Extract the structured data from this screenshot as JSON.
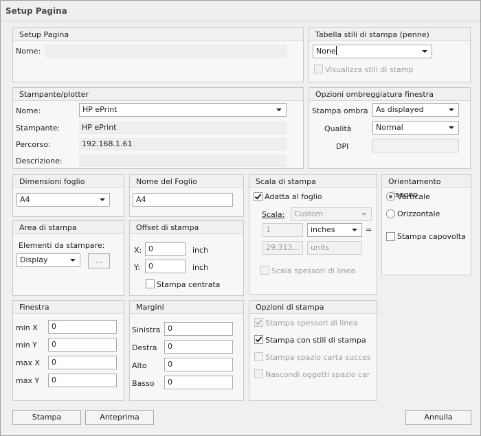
{
  "window": {
    "title": "Setup Pagina"
  },
  "setup": {
    "title": "Setup Pagina",
    "name_label": "Nome:",
    "name_value": ""
  },
  "pen": {
    "title": "Tabella stili di stampa (penne)",
    "value": "None",
    "view_label": "Visualizza stili di stamp"
  },
  "printer": {
    "title": "Stampante/plotter",
    "name_label": "Nome:",
    "name_value": "HP ePrint",
    "printer_label": "Stampante:",
    "printer_value": "HP ePrint",
    "path_label": "Percorso:",
    "path_value": "192.168.1.61",
    "desc_label": "Descrizione:",
    "desc_value": ""
  },
  "shade": {
    "title": "Opzioni ombreggiatura finestra",
    "shade_label": "Stampa ombra",
    "shade_value": "As displayed",
    "quality_label": "Qualità",
    "quality_value": "Normal",
    "dpi_label": "DPI",
    "dpi_value": ""
  },
  "paper": {
    "title": "Dimensioni foglio",
    "value": "A4"
  },
  "sheet": {
    "title": "Nome del Foglio",
    "value": "A4"
  },
  "scale": {
    "title": "Scala di stampa",
    "fit_label": "Adatta al foglio",
    "scale_label": "Scala:",
    "scale_value": "Custom",
    "num_value": "1",
    "unit_value": "inches",
    "equals": "=",
    "denom_value": "29.313...",
    "units_value": "units",
    "lineweight_label": "Scala spessori di linea"
  },
  "orient": {
    "title": "Orientamento disegno",
    "portrait_label": "Verticale",
    "landscape_label": "Orizzontale",
    "upside_label": "Stampa capovolta"
  },
  "area": {
    "title": "Area di stampa",
    "elements_label": "Elementi da stampare:",
    "value": "Display",
    "dots": "..."
  },
  "offset": {
    "title": "Offset di stampa",
    "x_label": "X:",
    "x_value": "0",
    "x_unit": "inch",
    "y_label": "Y:",
    "y_value": "0",
    "y_unit": "inch",
    "center_label": "Stampa centrata"
  },
  "window_box": {
    "title": "Finestra",
    "minx_label": "min X",
    "minx_value": "0",
    "miny_label": "min Y",
    "miny_value": "0",
    "maxx_label": "max X",
    "maxx_value": "0",
    "maxy_label": "max Y",
    "maxy_value": "0"
  },
  "margins": {
    "title": "Margini",
    "left_label": "Sinistra",
    "left_value": "0",
    "right_label": "Destra",
    "right_value": "0",
    "top_label": "Alto",
    "top_value": "0",
    "bottom_label": "Basso",
    "bottom_value": "0"
  },
  "options": {
    "title": "Opzioni di stampa",
    "opt1": "Stampa spessori di linea",
    "opt2": "Stampa con stili di stampa",
    "opt3": "Stampa spazio carta succes",
    "opt4": "Nascondi oggetti spazio car"
  },
  "buttons": {
    "print": "Stampa",
    "preview": "Anteprima",
    "cancel": "Annulla"
  }
}
